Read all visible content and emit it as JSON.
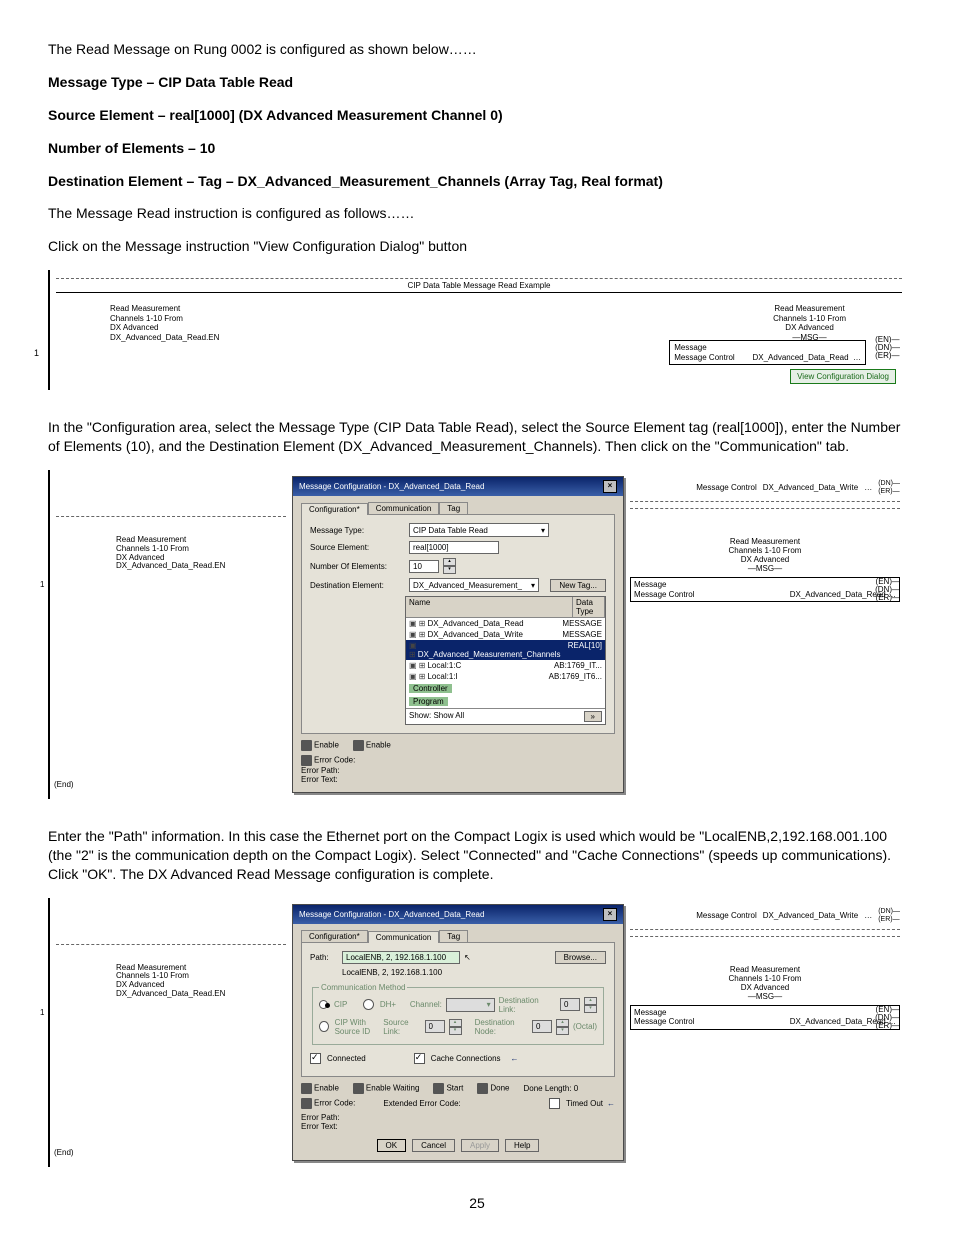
{
  "intro": "The Read Message on Rung 0002 is configured as shown below……",
  "spec": {
    "l1": "Message Type – CIP Data Table Read",
    "l2": "Source Element – real[1000] (DX Advanced Measurement Channel 0)",
    "l3": "Number of Elements – 10",
    "l4": "Destination Element – Tag – DX_Advanced_Measurement_Channels (Array Tag, Real format)"
  },
  "p2": "The Message Read instruction is configured as follows……",
  "p3": "Click on the Message instruction \"View Configuration Dialog\" button",
  "fig1": {
    "title": "CIP Data Table Message Read Example",
    "note": "Read Measurement\nChannels 1-10 From\nDX Advanced\nDX_Advanced_Data_Read.EN",
    "note2": "Read Measurement\nChannels 1-10 From\nDX Advanced\n—MSG—",
    "msg": "Message\nMessage Control        DX_Advanced_Data_Read  …",
    "en": "(EN)—",
    "dn": "(DN)—",
    "er": "(ER)—",
    "btn": "View Configuration Dialog",
    "rung": "1"
  },
  "p4": "In the \"Configuration area, select the Message Type (CIP Data Table Read), select the Source Element tag (real[1000]), enter the Number of Elements (10), and the Destination Element (DX_Advanced_Measurement_Channels). Then click on the \"Communication\" tab.",
  "dlg": {
    "title": "Message Configuration - DX_Advanced_Data_Read",
    "tabs": {
      "cfg": "Configuration*",
      "comm": "Communication",
      "tag": "Tag"
    },
    "msgtype_l": "Message Type:",
    "msgtype": "CIP Data Table Read",
    "src_l": "Source Element:",
    "src": "real[1000]",
    "num_l": "Number Of Elements:",
    "num": "10",
    "dst_l": "Destination Element:",
    "dst": "DX_Advanced_Measurement_",
    "newtag": "New Tag...",
    "browser": {
      "hdr_name": "Name",
      "hdr_type": "Data Type",
      "rows": [
        {
          "n": "DX_Advanced_Data_Read",
          "t": "MESSAGE"
        },
        {
          "n": "DX_Advanced_Data_Write",
          "t": "MESSAGE"
        },
        {
          "n": "DX_Advanced_Measurement_Channels",
          "t": "REAL[10]",
          "sel": true
        },
        {
          "n": "Local:1:C",
          "t": "AB:1769_IT..."
        },
        {
          "n": "Local:1:I",
          "t": "AB:1769_IT6..."
        }
      ],
      "ctrl": "Controller",
      "prog": "Program",
      "show": "Show: Show All"
    },
    "enable": "Enable",
    "enablew": "Enable Waiting",
    "start": "Start",
    "done": "Done",
    "donelen": "Done Length: 0",
    "errcode": "Error Code:",
    "exterr": "Extended Error Code:",
    "timed": "Timed Out",
    "errpath": "Error Path:",
    "errtext": "Error Text:",
    "ok": "OK",
    "cancel": "Cancel",
    "apply": "Apply",
    "help": "Help"
  },
  "dlg2": {
    "path_l": "Path:",
    "path": "LocalENB, 2, 192.168.1.100",
    "path_echo": "LocalENB, 2, 192.168.1.100",
    "browse": "Browse...",
    "cm": "Communication Method",
    "cip": "CIP",
    "dh": "DH+",
    "channel": "Channel:",
    "destlink": "Destination Link:",
    "cipsrc": "CIP With\nSource ID",
    "srclink": "Source Link:",
    "destnode": "Destination Node:",
    "octal": "(Octal)",
    "connected": "Connected",
    "cache": "Cache Connections",
    "arrow": "←"
  },
  "side": {
    "msgctrl": "Message Control",
    "write": "DX_Advanced_Data_Write",
    "read": "DX_Advanced_Data_Read",
    "msg": "Message",
    "note": "Read Measurement\nChannels 1-10 From\nDX Advanced\n—MSG—",
    "en": "(EN)—",
    "dn": "(DN)—",
    "er": "(ER)—"
  },
  "p5": "Enter the \"Path\" information. In this case the Ethernet port on the Compact Logix is used which would be \"LocalENB,2,192.168.001.100 (the \"2\" is the communication depth on the Compact Logix). Select \"Connected\" and \"Cache Connections\" (speeds up communications). Click \"OK\". The DX Advanced Read Message configuration is complete.",
  "rung_end": "(End)",
  "page": "25"
}
